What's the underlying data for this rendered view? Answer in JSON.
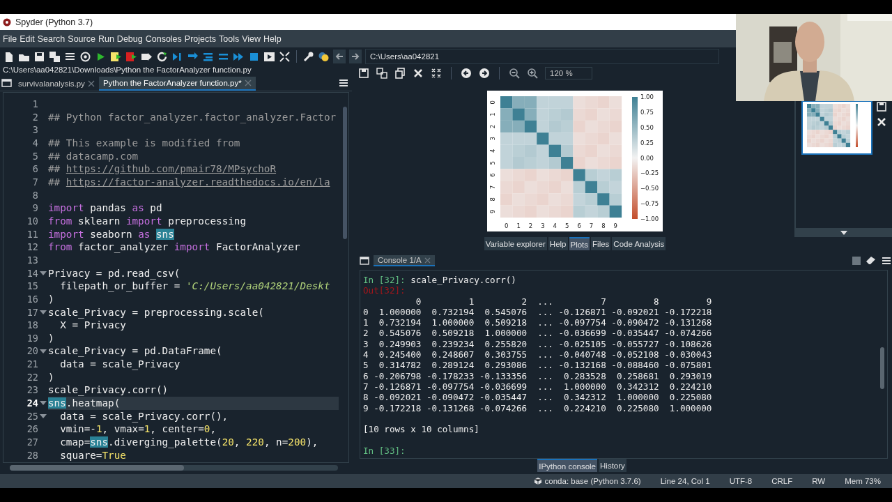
{
  "window": {
    "title": "Spyder (Python 3.7)"
  },
  "menu": [
    "File",
    "Edit",
    "Search",
    "Source",
    "Run",
    "Debug",
    "Consoles",
    "Projects",
    "Tools",
    "View",
    "Help"
  ],
  "working_directory": "C:\\Users\\aa042821",
  "editor": {
    "file_path": "C:\\Users\\aa042821\\Downloads\\Python the FactorAnalyzer function.py",
    "tabs": [
      {
        "label": "survivalanalysis.py",
        "selected": false
      },
      {
        "label": "Python the FactorAnalyzer function.py*",
        "selected": true
      }
    ],
    "lines": [
      {
        "number": "1",
        "foldable": false,
        "current": false
      },
      {
        "number": "2",
        "foldable": false,
        "current": false,
        "tokens": [
          {
            "kind": "comment",
            "text": "## Python factor_analyzer.factor_analyzer.Factor"
          }
        ]
      },
      {
        "number": "3",
        "foldable": false,
        "current": false
      },
      {
        "number": "4",
        "foldable": false,
        "current": false,
        "tokens": [
          {
            "kind": "comment",
            "text": "## This example is modified from"
          }
        ]
      },
      {
        "number": "5",
        "foldable": false,
        "current": false,
        "tokens": [
          {
            "kind": "comment",
            "text": "## datacamp.com"
          }
        ]
      },
      {
        "number": "6",
        "foldable": false,
        "current": false,
        "tokens": [
          {
            "kind": "comment",
            "text": "## "
          },
          {
            "kind": "link",
            "text": "https://github.com/pmair78/MPsychoR"
          }
        ]
      },
      {
        "number": "7",
        "foldable": false,
        "current": false,
        "tokens": [
          {
            "kind": "comment",
            "text": "## "
          },
          {
            "kind": "link",
            "text": "https://factor-analyzer.readthedocs.io/en/la"
          }
        ]
      },
      {
        "number": "8",
        "foldable": false,
        "current": false
      },
      {
        "number": "9",
        "foldable": false,
        "current": false,
        "tokens": [
          {
            "kind": "keyword",
            "text": "import"
          },
          {
            "kind": "plain",
            "text": " pandas "
          },
          {
            "kind": "keyword",
            "text": "as"
          },
          {
            "kind": "plain",
            "text": " pd"
          }
        ]
      },
      {
        "number": "10",
        "foldable": false,
        "current": false,
        "tokens": [
          {
            "kind": "keyword",
            "text": "from"
          },
          {
            "kind": "plain",
            "text": " sklearn "
          },
          {
            "kind": "keyword",
            "text": "import"
          },
          {
            "kind": "plain",
            "text": " preprocessing"
          }
        ]
      },
      {
        "number": "11",
        "foldable": false,
        "current": false,
        "tokens": [
          {
            "kind": "keyword",
            "text": "import"
          },
          {
            "kind": "plain",
            "text": " seaborn "
          },
          {
            "kind": "keyword",
            "text": "as "
          },
          {
            "kind": "match",
            "text": "sns"
          }
        ]
      },
      {
        "number": "12",
        "foldable": false,
        "current": false,
        "tokens": [
          {
            "kind": "keyword",
            "text": "from"
          },
          {
            "kind": "plain",
            "text": " factor_analyzer "
          },
          {
            "kind": "keyword",
            "text": "import"
          },
          {
            "kind": "plain",
            "text": " FactorAnalyzer"
          }
        ]
      },
      {
        "number": "13",
        "foldable": false,
        "current": false
      },
      {
        "number": "14",
        "foldable": true,
        "current": false,
        "tokens": [
          {
            "kind": "plain",
            "text": "Privacy = pd.read_csv("
          }
        ]
      },
      {
        "number": "15",
        "foldable": false,
        "current": false,
        "tokens": [
          {
            "kind": "plain",
            "text": "  filepath_or_buffer = "
          },
          {
            "kind": "string",
            "text": "'C:/Users/aa042821/Deskt"
          }
        ]
      },
      {
        "number": "16",
        "foldable": false,
        "current": false,
        "tokens": [
          {
            "kind": "plain",
            "text": ")"
          }
        ]
      },
      {
        "number": "17",
        "foldable": true,
        "current": false,
        "tokens": [
          {
            "kind": "plain",
            "text": "scale_Privacy = preprocessing.scale("
          }
        ]
      },
      {
        "number": "18",
        "foldable": false,
        "current": false,
        "tokens": [
          {
            "kind": "plain",
            "text": "  X = Privacy"
          }
        ]
      },
      {
        "number": "19",
        "foldable": false,
        "current": false,
        "tokens": [
          {
            "kind": "plain",
            "text": ")"
          }
        ]
      },
      {
        "number": "20",
        "foldable": true,
        "current": false,
        "tokens": [
          {
            "kind": "plain",
            "text": "scale_Privacy = pd.DataFrame("
          }
        ]
      },
      {
        "number": "21",
        "foldable": false,
        "current": false,
        "tokens": [
          {
            "kind": "plain",
            "text": "  data = scale_Privacy"
          }
        ]
      },
      {
        "number": "22",
        "foldable": false,
        "current": false,
        "tokens": [
          {
            "kind": "plain",
            "text": ")"
          }
        ]
      },
      {
        "number": "23",
        "foldable": false,
        "current": false,
        "tokens": [
          {
            "kind": "plain",
            "text": "scale_Privacy.corr()"
          }
        ]
      },
      {
        "number": "24",
        "foldable": true,
        "current": true,
        "tokens": [
          {
            "kind": "match",
            "text": "sns"
          },
          {
            "kind": "plain",
            "text": ".heatmap("
          }
        ]
      },
      {
        "number": "25",
        "foldable": true,
        "current": false,
        "tokens": [
          {
            "kind": "plain",
            "text": "  data = scale_Privacy.corr(),"
          }
        ]
      },
      {
        "number": "26",
        "foldable": false,
        "current": false,
        "tokens": [
          {
            "kind": "plain",
            "text": "  vmin=-"
          },
          {
            "kind": "number",
            "text": "1"
          },
          {
            "kind": "plain",
            "text": ", vmax="
          },
          {
            "kind": "number",
            "text": "1"
          },
          {
            "kind": "plain",
            "text": ", center="
          },
          {
            "kind": "number",
            "text": "0"
          },
          {
            "kind": "plain",
            "text": ","
          }
        ]
      },
      {
        "number": "27",
        "foldable": false,
        "current": false,
        "tokens": [
          {
            "kind": "plain",
            "text": "  cmap="
          },
          {
            "kind": "match",
            "text": "sns"
          },
          {
            "kind": "plain",
            "text": ".diverging_palette("
          },
          {
            "kind": "number",
            "text": "20"
          },
          {
            "kind": "plain",
            "text": ", "
          },
          {
            "kind": "number",
            "text": "220"
          },
          {
            "kind": "plain",
            "text": ", n="
          },
          {
            "kind": "number",
            "text": "200"
          },
          {
            "kind": "plain",
            "text": "),"
          }
        ]
      },
      {
        "number": "28",
        "foldable": false,
        "current": false,
        "tokens": [
          {
            "kind": "plain",
            "text": "  square="
          },
          {
            "kind": "number",
            "text": "True"
          }
        ]
      }
    ]
  },
  "plots": {
    "zoom": "120 %",
    "figure": {
      "y_labels": [
        "0",
        "1",
        "2",
        "3",
        "4",
        "5",
        "6",
        "7",
        "8",
        "9"
      ],
      "x_labels": [
        "0",
        "1",
        "2",
        "3",
        "4",
        "5",
        "6",
        "7",
        "8",
        "9"
      ],
      "colorbar_labels": [
        "1.00",
        "0.75",
        "0.50",
        "0.25",
        "0.00",
        "−0.25",
        "−0.50",
        "−0.75",
        "−1.00"
      ]
    },
    "thumbnails": [
      {
        "selected": true
      }
    ]
  },
  "pane_tabs": [
    {
      "label": "Variable explorer",
      "selected": false
    },
    {
      "label": "Help",
      "selected": false
    },
    {
      "label": "Plots",
      "selected": true
    },
    {
      "label": "Files",
      "selected": false
    },
    {
      "label": "Code Analysis",
      "selected": false
    }
  ],
  "console": {
    "tabs": [
      {
        "label": "Console 1/A",
        "selected": true
      }
    ],
    "lines": [
      {
        "kind": "input",
        "prompt": "In [32]:",
        "text": "scale_Privacy.corr()"
      },
      {
        "kind": "output_prompt",
        "prompt": "Out[32]:"
      },
      {
        "kind": "output",
        "text": "          0         1         2  ...         7         8         9"
      },
      {
        "kind": "output",
        "text": "0  1.000000  0.732194  0.545076  ... -0.126871 -0.092021 -0.172218"
      },
      {
        "kind": "output",
        "text": "1  0.732194  1.000000  0.509218  ... -0.097754 -0.090472 -0.131268"
      },
      {
        "kind": "output",
        "text": "2  0.545076  0.509218  1.000000  ... -0.036699 -0.035447 -0.074266"
      },
      {
        "kind": "output",
        "text": "3  0.249903  0.239234  0.255820  ... -0.025105 -0.055727 -0.108626"
      },
      {
        "kind": "output",
        "text": "4  0.245400  0.248607  0.303755  ... -0.040748 -0.052108 -0.030043"
      },
      {
        "kind": "output",
        "text": "5  0.314782  0.289124  0.293086  ... -0.132168 -0.088460 -0.075801"
      },
      {
        "kind": "output",
        "text": "6 -0.206798 -0.178233 -0.133356  ...  0.283528  0.258681  0.293019"
      },
      {
        "kind": "output",
        "text": "7 -0.126871 -0.097754 -0.036699  ...  1.000000  0.342312  0.224210"
      },
      {
        "kind": "output",
        "text": "8 -0.092021 -0.090472 -0.035447  ...  0.342312  1.000000  0.225080"
      },
      {
        "kind": "output",
        "text": "9 -0.172218 -0.131268 -0.074266  ...  0.224210  0.225080  1.000000"
      },
      {
        "kind": "gap"
      },
      {
        "kind": "output",
        "text": "[10 rows x 10 columns]"
      },
      {
        "kind": "gap"
      },
      {
        "kind": "input",
        "prompt": "In [33]:"
      }
    ]
  },
  "console_tabs": [
    {
      "label": "IPython console",
      "selected": true
    },
    {
      "label": "History",
      "selected": false
    }
  ],
  "status_bar": [
    {
      "kind": "env",
      "text": "conda: base (Python 3.7.6)"
    },
    {
      "kind": "plain",
      "text": "Line 24, Col 1"
    },
    {
      "kind": "plain",
      "text": "UTF-8"
    },
    {
      "kind": "plain",
      "text": "CRLF"
    },
    {
      "kind": "plain",
      "text": "RW"
    },
    {
      "kind": "plain",
      "text": "Mem 73%"
    }
  ]
}
